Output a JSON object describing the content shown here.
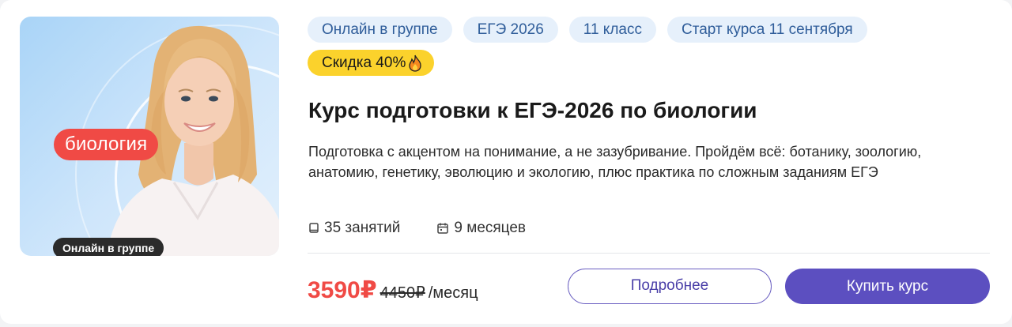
{
  "cover": {
    "subject_label": "биология",
    "format_label": "Онлайн в группе"
  },
  "tags": [
    "Онлайн в группе",
    "ЕГЭ 2026",
    "11 класс",
    "Старт курса 11 сентября"
  ],
  "discount": {
    "label": "Скидка 40%",
    "icon": "fire-icon"
  },
  "course": {
    "title": "Курс подготовки к ЕГЭ-2026 по биологии",
    "description": "Подготовка с акцентом на понимание, а не зазубривание. Пройдём всё: ботанику, зоологию, анатомию, генетику, эволюцию и экологию, плюс практика по сложным заданиям ЕГЭ"
  },
  "meta": {
    "lessons": "35 занятий",
    "lessons_icon": "book-icon",
    "duration": "9 месяцев",
    "duration_icon": "calendar-icon"
  },
  "price": {
    "current": "3590₽",
    "old": "4450₽",
    "period": "/месяц"
  },
  "actions": {
    "more_label": "Подробнее",
    "buy_label": "Купить курс"
  },
  "colors": {
    "accent": "#5c4fc0",
    "sale": "#f04a45",
    "discount_bg": "#fbd22c",
    "tag_bg": "#e6f0fb"
  }
}
